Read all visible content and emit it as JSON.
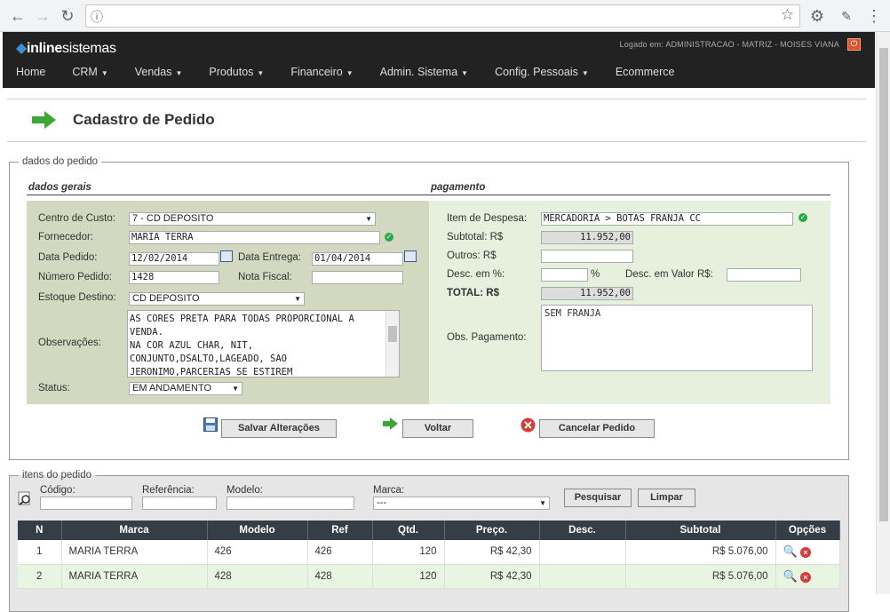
{
  "browser": {
    "back": "←",
    "forward": "→",
    "reload": "↻",
    "info": "ⓘ",
    "star": "☆",
    "gear": "⚙",
    "menu": "⋮"
  },
  "header": {
    "logo_bold": "inline",
    "logo_rest": "sistemas",
    "user": "Logado em: ADMINISTRACAO - MATRIZ - MOISES VIANA",
    "logout": "⏻"
  },
  "menu": [
    "Home",
    "CRM",
    "Vendas",
    "Produtos",
    "Financeiro",
    "Admin. Sistema",
    "Config. Pessoais",
    "Ecommerce"
  ],
  "menu_caret": "▼",
  "page_title": "Cadastro de Pedido",
  "order": {
    "legend": "dados do pedido",
    "general_title": "dados gerais",
    "payment_title": "pagamento",
    "centro_custo_label": "Centro de Custo:",
    "centro_custo": "7 - CD DEPOSITO",
    "fornecedor_label": "Fornecedor:",
    "fornecedor": "MARIA TERRA",
    "data_pedido_label": "Data Pedido:",
    "data_pedido": "12/02/2014",
    "data_entrega_label": "Data Entrega:",
    "data_entrega": "01/04/2014",
    "numero_pedido_label": "Número Pedido:",
    "numero_pedido": "1428",
    "nota_fiscal_label": "Nota Fiscal:",
    "nota_fiscal": "",
    "estoque_label": "Estoque Destino:",
    "estoque": "CD DEPOSITO",
    "obs_label": "Observações:",
    "obs": "AS CORES PRETA PARA TODAS PROPORCIONAL A VENDA.\nNA COR AZUL CHAR, NIT, CONJUNTO,DSALTO,LAGEADO, SAO JERONIMO,PARCERIAS SE ESTIREM",
    "status_label": "Status:",
    "status": "EM ANDAMENTO",
    "item_despesa_label": "Item de Despesa:",
    "item_despesa": "MERCADORIA > BOTAS FRANJA CC",
    "subtotal_label": "Subtotal: R$",
    "subtotal": "11.952,00",
    "outros_label": "Outros: R$",
    "outros": "",
    "desc_pct_label": "Desc. em %:",
    "pct_sign": "%",
    "desc_valor_label": "Desc. em Valor R$:",
    "total_label": "TOTAL: R$",
    "total": "11.952,00",
    "obs_pag_label": "Obs. Pagamento:",
    "obs_pag": "SEM FRANJA"
  },
  "actions": {
    "save": "Salvar Alterações",
    "back": "Voltar",
    "cancel": "Cancelar Pedido"
  },
  "items": {
    "legend": "itens do pedido",
    "codigo_label": "Código:",
    "referencia_label": "Referência:",
    "modelo_label": "Modelo:",
    "marca_label": "Marca:",
    "marca_value": "---",
    "search": "Pesquisar",
    "clear": "Limpar",
    "columns": [
      "N",
      "Marca",
      "Modelo",
      "Ref",
      "Qtd.",
      "Preço.",
      "Desc.",
      "Subtotal",
      "Opções"
    ],
    "rows": [
      [
        "1",
        "MARIA TERRA",
        "426",
        "426",
        "120",
        "R$ 42,30",
        "",
        "R$ 5.076,00"
      ],
      [
        "2",
        "MARIA TERRA",
        "428",
        "428",
        "120",
        "R$ 42,30",
        "",
        "R$ 5.076,00"
      ]
    ]
  }
}
